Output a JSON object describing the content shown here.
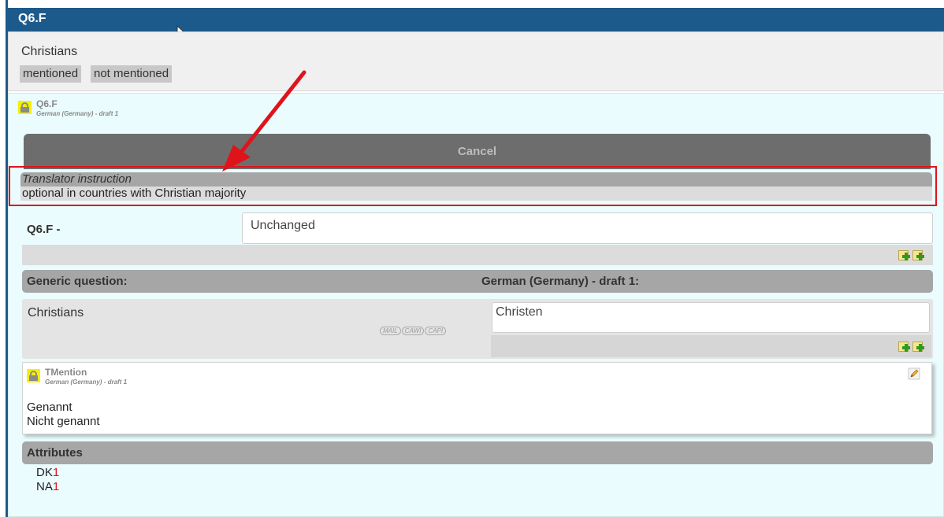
{
  "window": {
    "title": "Q6.F"
  },
  "generic": {
    "title": "Christians",
    "chips": [
      "mentioned",
      "not mentioned"
    ]
  },
  "translation": {
    "question_code": "Q6.F",
    "language_draft": "German (Germany) - draft 1",
    "cancel_label": "Cancel",
    "translator_instruction": {
      "label": "Translator instruction",
      "text": "optional in countries with Christian majority"
    },
    "code_row": {
      "label": "Q6.F -",
      "value": "Unchanged"
    },
    "columns": {
      "generic": "Generic question:",
      "target": "German (Germany) - draft 1:"
    },
    "question_text": {
      "source": "Christians",
      "modes": [
        "MAIL",
        "CAWI",
        "CAPI"
      ],
      "target_value": "Christen"
    },
    "mention": {
      "title": "TMention",
      "language_draft": "German (Germany) - draft 1",
      "options": [
        "Genannt",
        "Nicht genannt"
      ]
    },
    "attributes": {
      "label": "Attributes",
      "items": [
        {
          "name": "DK",
          "value": "1"
        },
        {
          "name": "NA",
          "value": "1"
        }
      ]
    }
  },
  "icons": {
    "lock": "lock-icon",
    "add": "add-translation-icon",
    "edit": "pencil-icon",
    "annotation": "red-arrow"
  },
  "colors": {
    "titlebar": "#1d5a8c",
    "highlight": "#e0131b",
    "lock": "#f5f000"
  }
}
